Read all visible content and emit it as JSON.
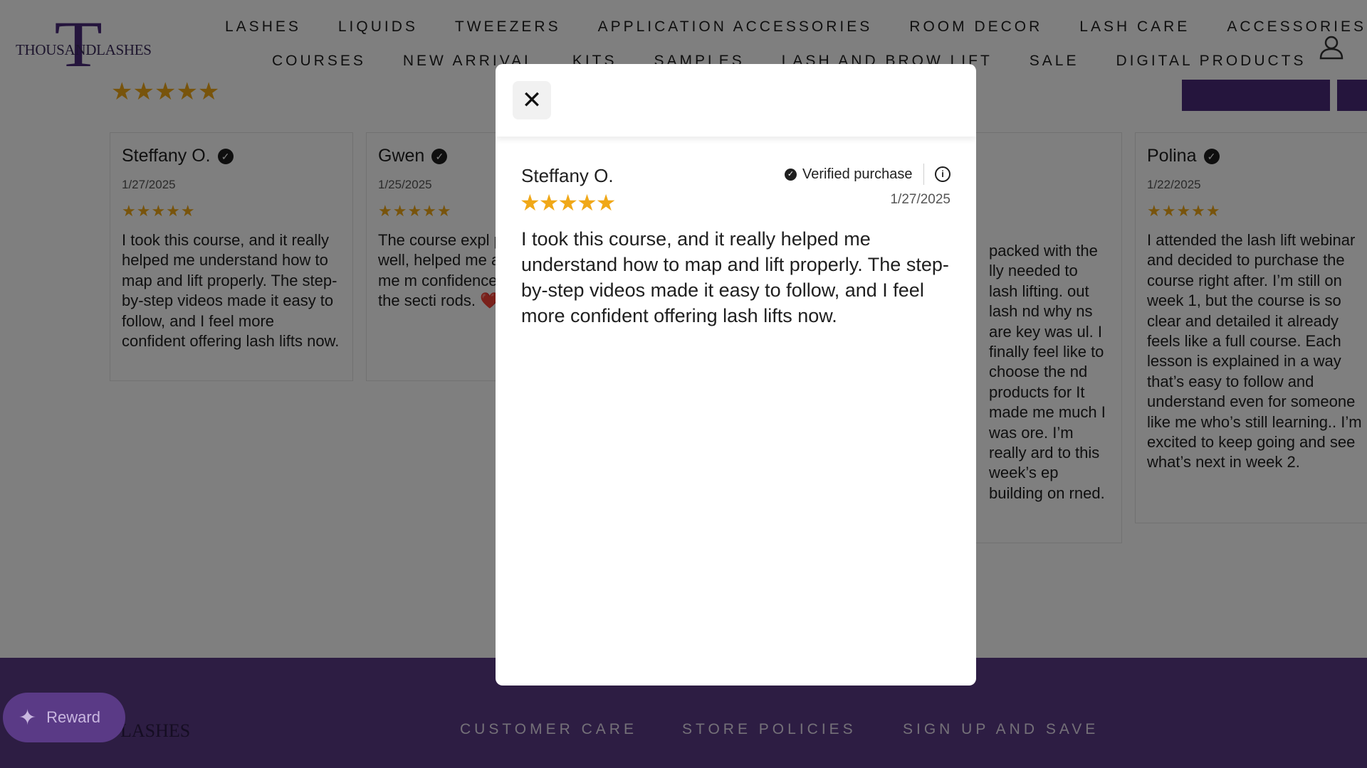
{
  "brand": {
    "logo_text": "THOUSANDLASHES"
  },
  "nav": {
    "row1": [
      "LASHES",
      "LIQUIDS",
      "TWEEZERS",
      "APPLICATION ACCESSORIES",
      "ROOM DECOR",
      "LASH CARE",
      "ACCESSORIES"
    ],
    "row2": [
      "COURSES",
      "NEW ARRIVAL",
      "KITS",
      "SAMPLES",
      "LASH AND BROW LIFT",
      "SALE",
      "DIGITAL PRODUCTS"
    ]
  },
  "reviews": {
    "rating_stars": "★★★★★",
    "cards": [
      {
        "name": "Steffany O.",
        "date": "1/27/2025",
        "stars": "★★★★★",
        "text": "I took this course, and it really helped me understand how to map and lift properly. The step-by-step videos made it easy to follow, and I feel more confident offering lash lifts now."
      },
      {
        "name": "Gwen",
        "date": "1/25/2025",
        "stars": "★★★★★",
        "text": "The course expl process so well, helped me avoi and gave me m confidence with I loved the secti rods. ❤️"
      },
      {
        "text": "packed with the lly needed to lash lifting. out lash nd why ns are key was ul. I finally feel like to choose the nd products for It made me much I was ore. I’m really ard to this week’s ep building on rned."
      },
      {
        "name": "Polina",
        "date": "1/22/2025",
        "stars": "★★★★★",
        "text": "I attended the lash lift webinar and decided to purchase the course right after. I’m still on week 1, but the course is so clear and detailed it already feels like a full course. Each lesson is explained in a way that’s easy to follow and understand  even for someone like me who’s still learning.. I’m excited to keep going and see what’s next in week 2."
      }
    ]
  },
  "modal": {
    "close_glyph": "✕",
    "name": "Steffany O.",
    "verified_label": "Verified purchase",
    "info_glyph": "i",
    "stars": "★★★★★",
    "date": "1/27/2025",
    "text": "I took this course, and it really helped me understand how to map and lift properly. The step-by-step videos made it easy to follow, and I feel more confident offering lash lifts now."
  },
  "footer": {
    "logo_text": "THOUSANDLASHES",
    "headings": [
      "CUSTOMER CARE",
      "STORE POLICIES",
      "SIGN UP AND SAVE"
    ]
  },
  "reward": {
    "label": "Reward"
  },
  "icons": {
    "account": "user-icon",
    "check": "check-circle-icon",
    "info": "info-icon",
    "close": "close-icon",
    "reward": "party-popper-icon"
  },
  "colors": {
    "brand_purple": "#4a2a7a",
    "footer_purple": "#5a3a86",
    "star_gold": "#f0a818"
  }
}
